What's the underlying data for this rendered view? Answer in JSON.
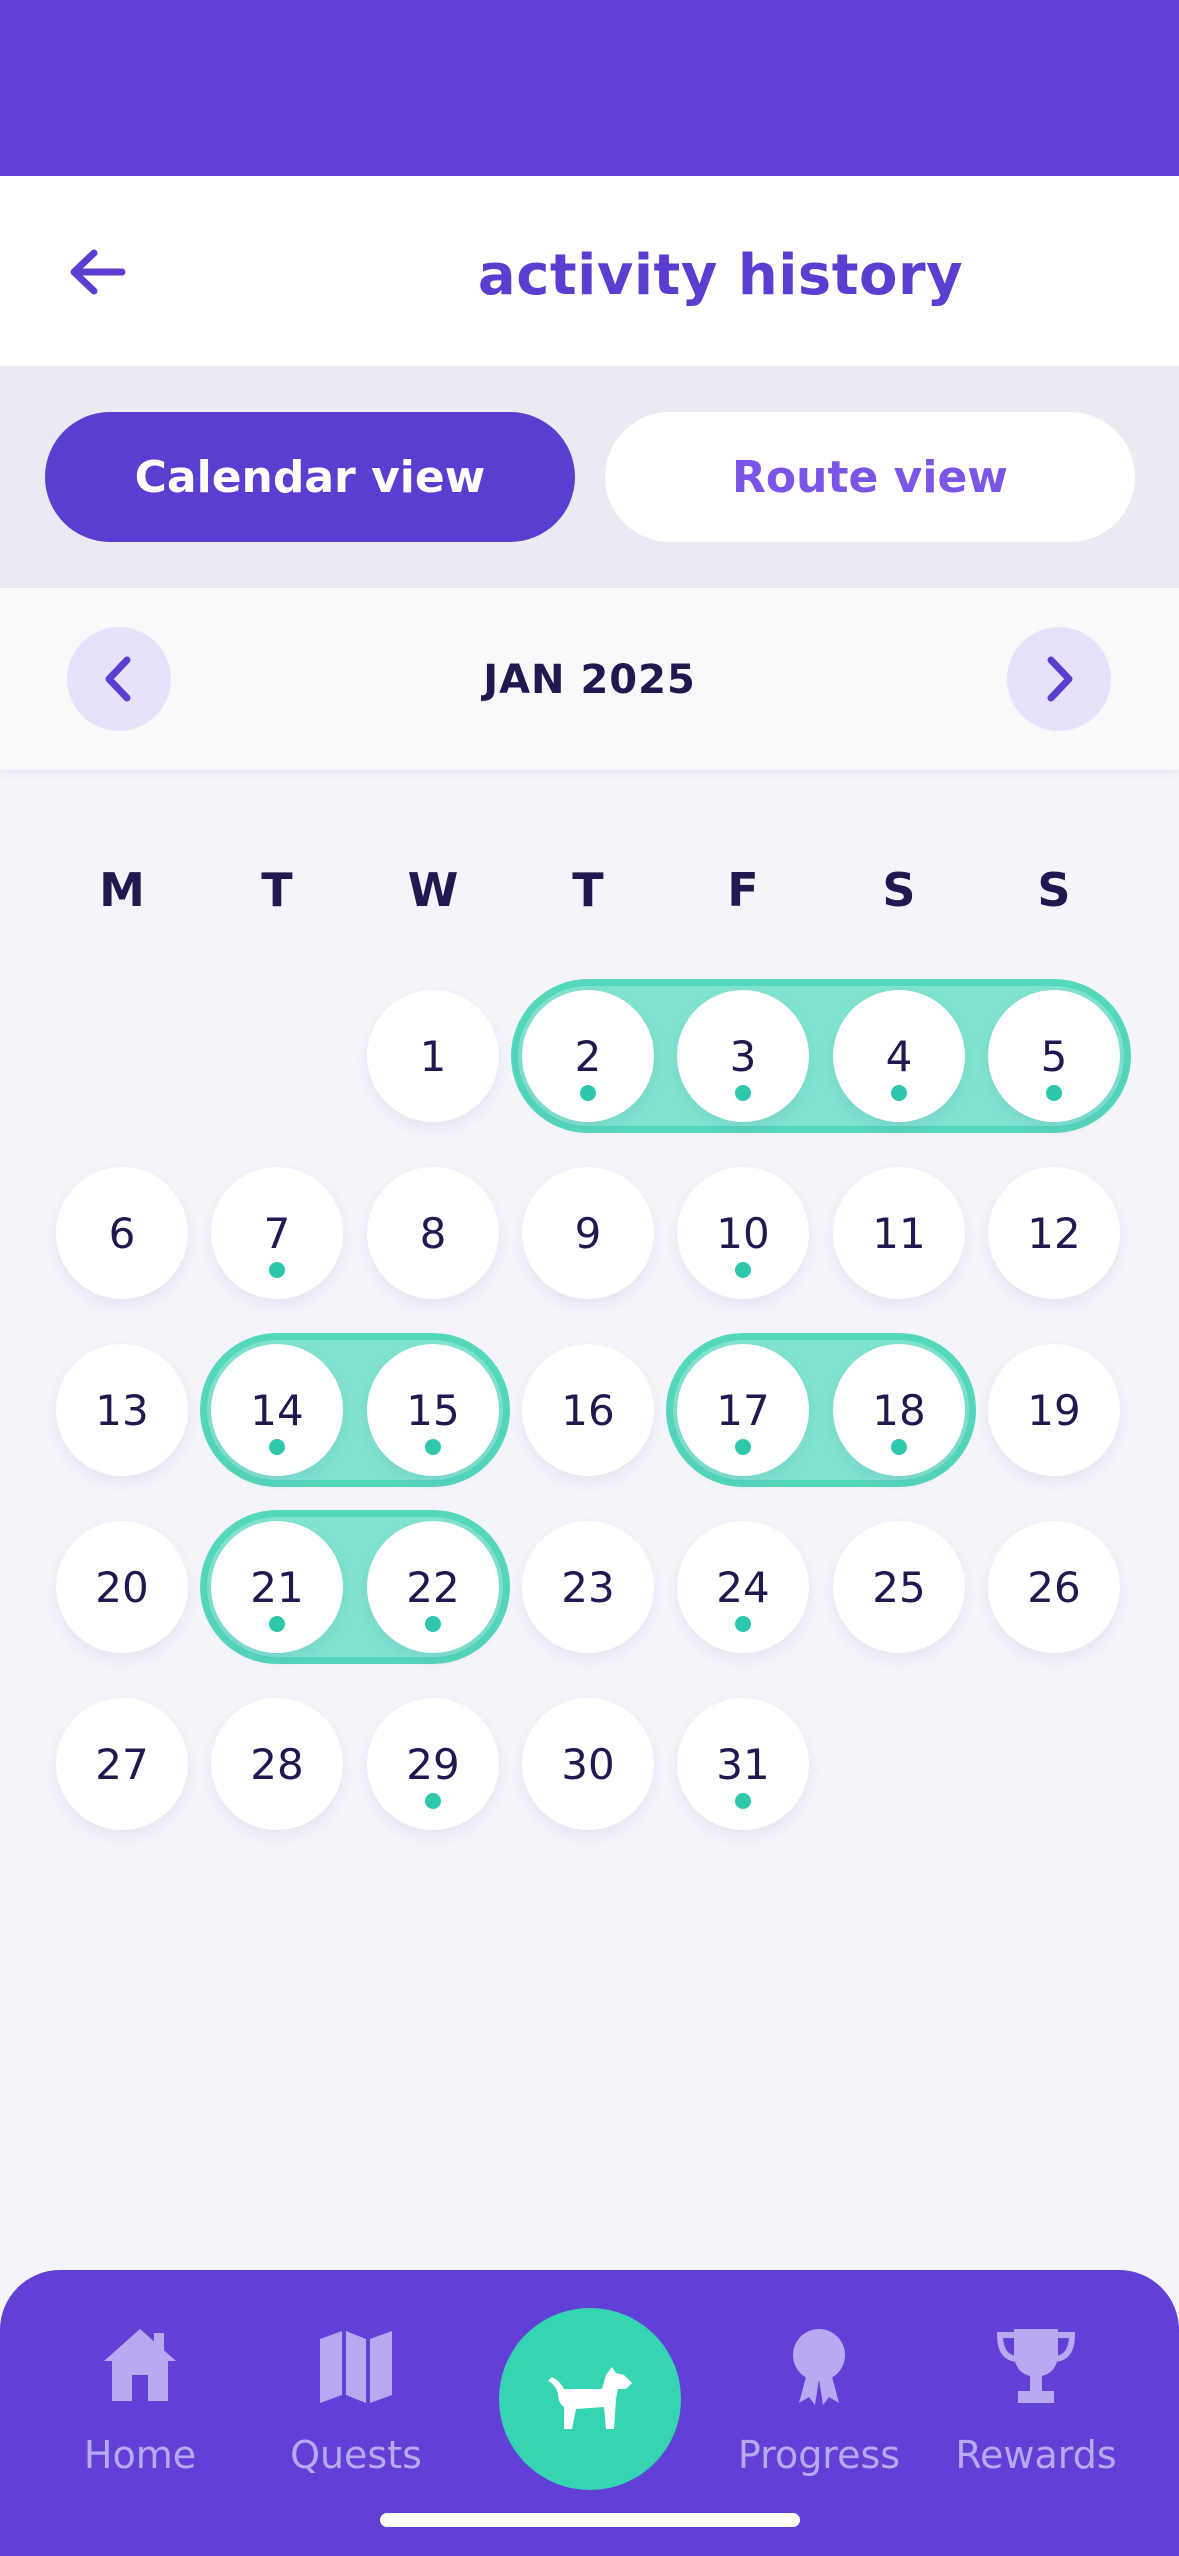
{
  "header": {
    "title": "activity history"
  },
  "view_toggle": {
    "calendar_label": "Calendar view",
    "route_label": "Route view",
    "selected": "Calendar view"
  },
  "calendar": {
    "month_label": "JAN 2025",
    "weekdays": [
      "M",
      "T",
      "W",
      "T",
      "F",
      "S",
      "S"
    ],
    "days": [
      {
        "label": "1",
        "activity": false
      },
      {
        "label": "2",
        "activity": true
      },
      {
        "label": "3",
        "activity": true
      },
      {
        "label": "4",
        "activity": true
      },
      {
        "label": "5",
        "activity": true
      },
      {
        "label": "6",
        "activity": false
      },
      {
        "label": "7",
        "activity": true
      },
      {
        "label": "8",
        "activity": false
      },
      {
        "label": "9",
        "activity": false
      },
      {
        "label": "10",
        "activity": true
      },
      {
        "label": "11",
        "activity": false
      },
      {
        "label": "12",
        "activity": false
      },
      {
        "label": "13",
        "activity": false
      },
      {
        "label": "14",
        "activity": true
      },
      {
        "label": "15",
        "activity": true
      },
      {
        "label": "16",
        "activity": false
      },
      {
        "label": "17",
        "activity": true
      },
      {
        "label": "18",
        "activity": true
      },
      {
        "label": "19",
        "activity": false
      },
      {
        "label": "20",
        "activity": false
      },
      {
        "label": "21",
        "activity": true
      },
      {
        "label": "22",
        "activity": true
      },
      {
        "label": "23",
        "activity": false
      },
      {
        "label": "24",
        "activity": true
      },
      {
        "label": "25",
        "activity": false
      },
      {
        "label": "26",
        "activity": false
      },
      {
        "label": "27",
        "activity": false
      },
      {
        "label": "28",
        "activity": false
      },
      {
        "label": "29",
        "activity": true
      },
      {
        "label": "30",
        "activity": false
      },
      {
        "label": "31",
        "activity": true
      }
    ],
    "streaks": [
      [
        2,
        5
      ],
      [
        14,
        15
      ],
      [
        17,
        18
      ],
      [
        21,
        22
      ]
    ]
  },
  "bottom_nav": {
    "items": [
      {
        "label": "Home",
        "icon": "home-icon"
      },
      {
        "label": "Quests",
        "icon": "map-icon"
      },
      {
        "label": "Progress",
        "icon": "badge-icon"
      },
      {
        "label": "Rewards",
        "icon": "trophy-icon"
      }
    ],
    "center_icon": "dog-icon"
  },
  "colors": {
    "primary": "#6140d6",
    "accent": "#35d5b3",
    "streak": "#80e3cf",
    "text": "#22174f"
  }
}
